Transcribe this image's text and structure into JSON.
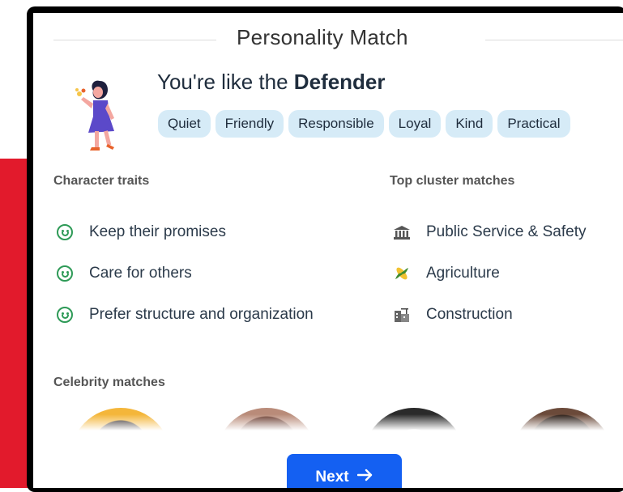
{
  "header": {
    "title": "Personality Match"
  },
  "result": {
    "prefix": "You're like the ",
    "type": "Defender"
  },
  "chips": [
    "Quiet",
    "Friendly",
    "Responsible",
    "Loyal",
    "Kind",
    "Practical"
  ],
  "traits": {
    "label": "Character traits",
    "items": [
      "Keep their promises",
      "Care for others",
      "Prefer structure and organization"
    ]
  },
  "clusters": {
    "label": "Top cluster matches",
    "items": [
      {
        "label": "Public Service & Safety",
        "icon": "government-building-icon"
      },
      {
        "label": "Agriculture",
        "icon": "corn-icon"
      },
      {
        "label": "Construction",
        "icon": "construction-site-icon"
      }
    ]
  },
  "celebrities": {
    "label": "Celebrity matches"
  },
  "actions": {
    "next_label": "Next",
    "next_icon": "arrow-right-icon"
  },
  "colors": {
    "accent": "#1460f2",
    "chip_bg": "#d6ebf7",
    "smile": "#2e9a57",
    "side_strip": "#e21a2c"
  }
}
